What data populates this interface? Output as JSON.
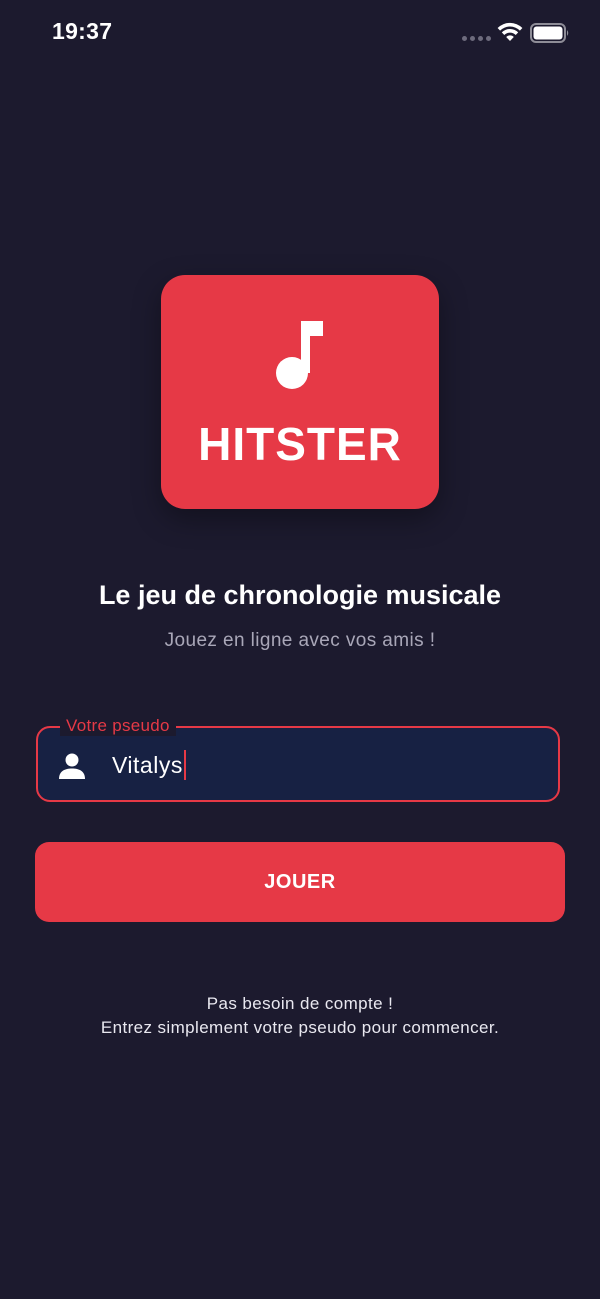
{
  "status_bar": {
    "time": "19:37",
    "icons": [
      "signal-dots",
      "wifi-icon",
      "battery-icon"
    ]
  },
  "logo": {
    "icon": "music-note-icon",
    "text": "HITSTER"
  },
  "tagline": "Le jeu de chronologie musicale",
  "subtitle": "Jouez en ligne avec vos amis !",
  "pseudo_field": {
    "label": "Votre pseudo",
    "value": "Vitalys",
    "icon": "user-icon"
  },
  "play_button": {
    "label": "JOUER"
  },
  "footer": {
    "line1": "Pas besoin de compte !",
    "line2": "Entrez simplement votre pseudo pour commencer."
  },
  "colors": {
    "background": "#1c1a2e",
    "accent": "#e63946",
    "field_background": "#172143",
    "subtitle_text": "#a9a7b8"
  }
}
